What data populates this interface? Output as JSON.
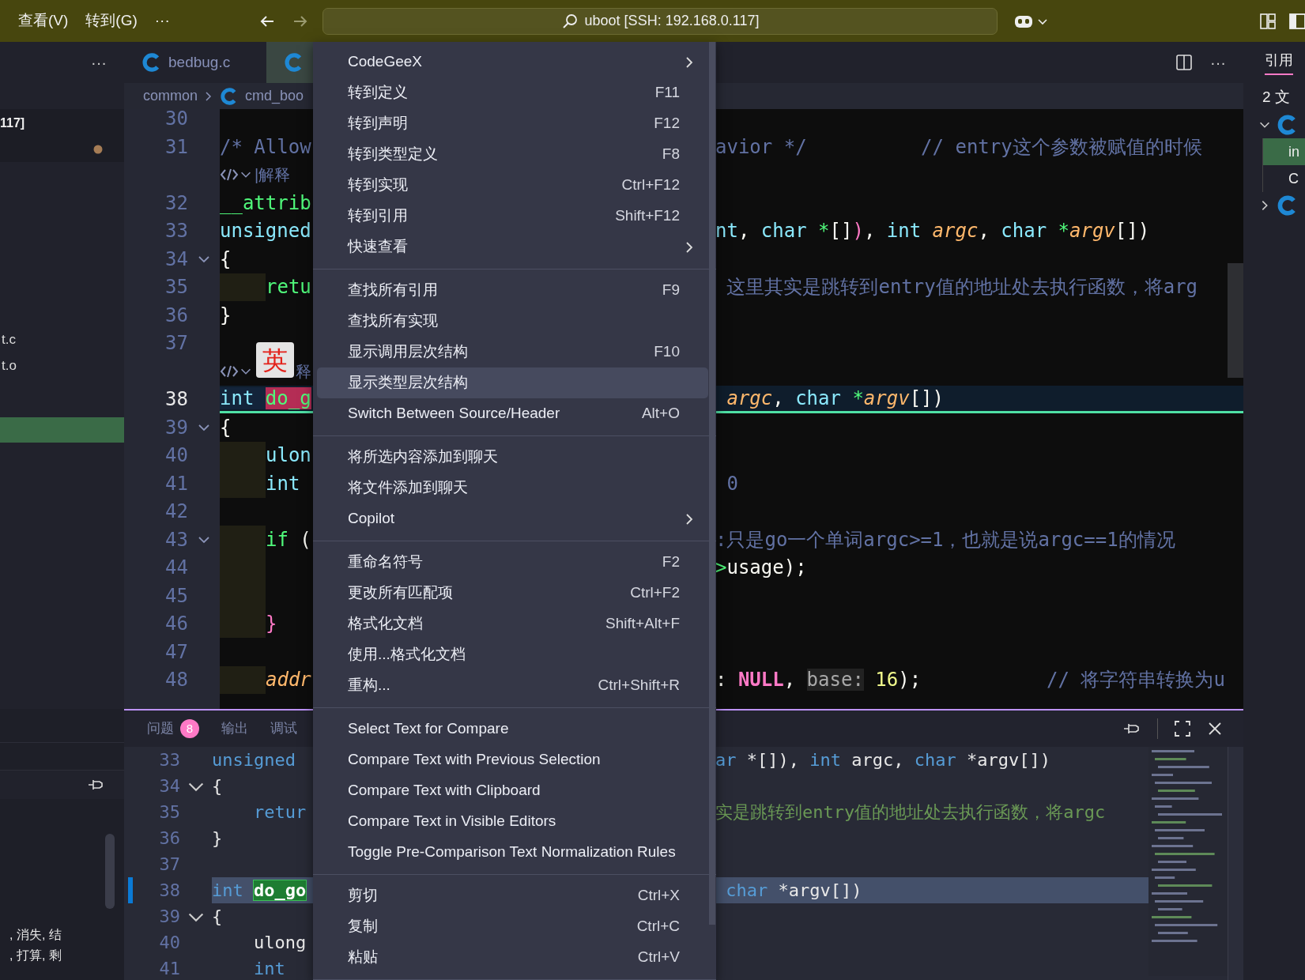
{
  "title_bar": {
    "menus": [
      "查看(V)",
      "转到(G)"
    ],
    "more": "···",
    "search": "uboot [SSH: 192.168.0.117]"
  },
  "sidebar": {
    "more": "···",
    "header": "117]",
    "modified": true,
    "files": [
      "t.c",
      "t.o"
    ],
    "notes": [
      ", 消失, 结",
      ", 打算, 剩"
    ]
  },
  "tabs": [
    {
      "label": "bedbug.c",
      "selected": false
    },
    {
      "selected": true
    }
  ],
  "tab_actions": {
    "more": "···"
  },
  "breadcrumb": [
    "common",
    "cmd_boo"
  ],
  "editor": {
    "lines": [
      {
        "kind": "code",
        "number": "30",
        "fold": false,
        "current": false,
        "guide": false
      },
      {
        "kind": "code",
        "number": "31",
        "fold": false,
        "current": false,
        "guide": false,
        "left": [
          {
            "text": "/* Allow",
            "kind": "comment"
          }
        ],
        "right": [
          {
            "text": "avior */          // entry这个参数被赋值的时候",
            "kind": "comment"
          }
        ]
      },
      {
        "kind": "lens",
        "text": "|解释"
      },
      {
        "kind": "code",
        "number": "32",
        "fold": false,
        "current": false,
        "guide": false,
        "left": [
          {
            "text": "__attrib",
            "kind": "func"
          }
        ]
      },
      {
        "kind": "code",
        "number": "33",
        "fold": false,
        "current": false,
        "guide": false,
        "left": [
          {
            "text": "unsigned",
            "kind": "type"
          }
        ],
        "right": [
          {
            "text": "nt",
            "kind": "type"
          },
          {
            "text": ", ",
            "kind": "plain"
          },
          {
            "text": "char",
            "kind": "type"
          },
          {
            "text": " *",
            "kind": "op"
          },
          {
            "text": "[]",
            "kind": "plain"
          },
          {
            "text": ")",
            "kind": "punct"
          },
          {
            "text": ", ",
            "kind": "plain"
          },
          {
            "text": "int",
            "kind": "type"
          },
          {
            "text": " argc",
            "kind": "param"
          },
          {
            "text": ", ",
            "kind": "plain"
          },
          {
            "text": "char",
            "kind": "type"
          },
          {
            "text": " *",
            "kind": "op"
          },
          {
            "text": "argv",
            "kind": "param"
          },
          {
            "text": "[])",
            "kind": "plain"
          }
        ]
      },
      {
        "kind": "code",
        "number": "34",
        "fold": true,
        "current": false,
        "guide": false,
        "left": [
          {
            "text": "{",
            "kind": "plain"
          }
        ]
      },
      {
        "kind": "code",
        "number": "35",
        "fold": false,
        "current": false,
        "guide": true,
        "left": [
          {
            "text": "retu",
            "kind": "func"
          }
        ],
        "right": [
          {
            "text": " 这里其实是跳转到entry值的地址处去执行函数，将arg",
            "kind": "comment"
          }
        ]
      },
      {
        "kind": "code",
        "number": "36",
        "fold": false,
        "current": false,
        "guide": false,
        "left": [
          {
            "text": "}",
            "kind": "plain"
          }
        ]
      },
      {
        "kind": "code",
        "number": "37",
        "fold": false,
        "current": false,
        "guide": false
      },
      {
        "kind": "lens",
        "text": "释",
        "ime": "英"
      },
      {
        "kind": "code",
        "number": "38",
        "fold": false,
        "current": true,
        "guide": false,
        "left": [
          {
            "text": "int ",
            "kind": "sel-type"
          },
          {
            "text": "do_g",
            "kind": "sel-name"
          }
        ],
        "right": [
          {
            "text": " argc",
            "kind": "param"
          },
          {
            "text": ", ",
            "kind": "plain"
          },
          {
            "text": "char",
            "kind": "type"
          },
          {
            "text": " *",
            "kind": "op"
          },
          {
            "text": "argv",
            "kind": "param"
          },
          {
            "text": "[])",
            "kind": "plain"
          }
        ]
      },
      {
        "kind": "code",
        "number": "39",
        "fold": true,
        "current": false,
        "guide": false,
        "left": [
          {
            "text": "{",
            "kind": "plain"
          }
        ]
      },
      {
        "kind": "code",
        "number": "40",
        "fold": false,
        "current": false,
        "guide": true,
        "left": [
          {
            "text": "ulon",
            "kind": "type"
          }
        ]
      },
      {
        "kind": "code",
        "number": "41",
        "fold": false,
        "current": false,
        "guide": true,
        "left": [
          {
            "text": "int",
            "kind": "type"
          }
        ],
        "right": [
          {
            "text": " 0",
            "kind": "comment"
          }
        ]
      },
      {
        "kind": "code",
        "number": "42",
        "fold": false,
        "current": false,
        "guide": false
      },
      {
        "kind": "code",
        "number": "43",
        "fold": true,
        "current": false,
        "guide": true,
        "left": [
          {
            "text": "if",
            "kind": "func"
          },
          {
            "text": " (",
            "kind": "plain"
          }
        ],
        "right": [
          {
            "text": ":只是go一个单词argc>=1，也就是说argc==1的情况",
            "kind": "comment"
          }
        ]
      },
      {
        "kind": "code",
        "number": "44",
        "fold": false,
        "current": false,
        "guide": true,
        "right": [
          {
            "text": ">",
            "kind": "op"
          },
          {
            "text": "usage);",
            "kind": "plain"
          }
        ]
      },
      {
        "kind": "code",
        "number": "45",
        "fold": false,
        "current": false,
        "guide": true
      },
      {
        "kind": "code",
        "number": "46",
        "fold": false,
        "current": false,
        "guide": true,
        "left": [
          {
            "text": "}",
            "kind": "punct"
          }
        ]
      },
      {
        "kind": "code",
        "number": "47",
        "fold": false,
        "current": false,
        "guide": false
      },
      {
        "kind": "code",
        "number": "48",
        "fold": false,
        "current": false,
        "guide": true,
        "left": [
          {
            "text": "addr",
            "kind": "param"
          }
        ],
        "right": [
          {
            "text": ": ",
            "kind": "plain"
          },
          {
            "text": "NULL",
            "kind": "const"
          },
          {
            "text": ", ",
            "kind": "plain"
          },
          {
            "text": "base:",
            "kind": "hint"
          },
          {
            "text": " 16",
            "kind": "number"
          },
          {
            "text": ");",
            "kind": "plain"
          },
          {
            "text": "           // 将字符串转换为u",
            "kind": "comment"
          }
        ]
      }
    ]
  },
  "panel": {
    "tabs": [
      {
        "label": "问题",
        "badge": "8",
        "selected": false
      },
      {
        "label": "输出",
        "selected": false
      },
      {
        "label": "调试",
        "selected": false
      }
    ],
    "lines": [
      {
        "kind": "code",
        "number": "33",
        "fold": false,
        "current": false,
        "left": [
          {
            "text": "unsigned",
            "kind": "type"
          }
        ],
        "right": [
          {
            "text": "ar",
            "kind": "type"
          },
          {
            "text": " *[]), ",
            "kind": "plain"
          },
          {
            "text": "int",
            "kind": "type"
          },
          {
            "text": " argc, ",
            "kind": "plain"
          },
          {
            "text": "char",
            "kind": "type"
          },
          {
            "text": " *argv[])",
            "kind": "plain"
          }
        ]
      },
      {
        "kind": "code",
        "number": "34",
        "fold": true,
        "current": false,
        "left": [
          {
            "text": "{",
            "kind": "plain"
          }
        ]
      },
      {
        "kind": "code",
        "number": "35",
        "fold": false,
        "current": false,
        "left": [
          {
            "text": "    retur",
            "kind": "type"
          }
        ],
        "right": [
          {
            "text": "实是跳转到entry值的地址处去执行函数，将argc",
            "kind": "comment"
          }
        ]
      },
      {
        "kind": "code",
        "number": "36",
        "fold": false,
        "current": false,
        "left": [
          {
            "text": "}",
            "kind": "plain"
          }
        ]
      },
      {
        "kind": "code",
        "number": "37",
        "fold": false,
        "current": false
      },
      {
        "kind": "code",
        "number": "38",
        "fold": false,
        "current": true,
        "left": [
          {
            "text": "int ",
            "kind": "type"
          },
          {
            "text": "do_go",
            "kind": "sel-name"
          }
        ],
        "right": [
          {
            "text": " char",
            "kind": "type"
          },
          {
            "text": " *argv[])",
            "kind": "plain"
          }
        ]
      },
      {
        "kind": "code",
        "number": "39",
        "fold": true,
        "current": false,
        "left": [
          {
            "text": "{",
            "kind": "plain"
          }
        ]
      },
      {
        "kind": "code",
        "number": "40",
        "fold": false,
        "current": false,
        "left": [
          {
            "text": "    ulong",
            "kind": "plain"
          }
        ]
      },
      {
        "kind": "code",
        "number": "41",
        "fold": false,
        "current": false,
        "left": [
          {
            "text": "    int",
            "kind": "type"
          }
        ]
      }
    ]
  },
  "references": {
    "tab": "引用",
    "summary": "2 文",
    "tree": [
      {
        "expanded": true,
        "children": [
          {
            "label": "in",
            "selected": true
          },
          {
            "label": "C",
            "selected": false
          }
        ]
      },
      {
        "expanded": false
      }
    ]
  },
  "context_menu": {
    "items": [
      {
        "kind": "item",
        "label": "CodeGeeX",
        "submenu": true,
        "highlighted": false
      },
      {
        "kind": "item",
        "label": "转到定义",
        "shortcut": "F11",
        "submenu": false,
        "highlighted": false
      },
      {
        "kind": "item",
        "label": "转到声明",
        "shortcut": "F12",
        "submenu": false,
        "highlighted": false
      },
      {
        "kind": "item",
        "label": "转到类型定义",
        "shortcut": "F8",
        "submenu": false,
        "highlighted": false
      },
      {
        "kind": "item",
        "label": "转到实现",
        "shortcut": "Ctrl+F12",
        "submenu": false,
        "highlighted": false
      },
      {
        "kind": "item",
        "label": "转到引用",
        "shortcut": "Shift+F12",
        "submenu": false,
        "highlighted": false
      },
      {
        "kind": "item",
        "label": "快速查看",
        "submenu": true,
        "highlighted": false
      },
      {
        "kind": "separator"
      },
      {
        "kind": "item",
        "label": "查找所有引用",
        "shortcut": "F9",
        "submenu": false,
        "highlighted": false
      },
      {
        "kind": "item",
        "label": "查找所有实现",
        "submenu": false,
        "highlighted": false
      },
      {
        "kind": "item",
        "label": "显示调用层次结构",
        "shortcut": "F10",
        "submenu": false,
        "highlighted": false
      },
      {
        "kind": "item",
        "label": "显示类型层次结构",
        "submenu": false,
        "highlighted": true
      },
      {
        "kind": "item",
        "label": "Switch Between Source/Header",
        "shortcut": "Alt+O",
        "submenu": false,
        "highlighted": false
      },
      {
        "kind": "separator"
      },
      {
        "kind": "item",
        "label": "将所选内容添加到聊天",
        "submenu": false,
        "highlighted": false
      },
      {
        "kind": "item",
        "label": "将文件添加到聊天",
        "submenu": false,
        "highlighted": false
      },
      {
        "kind": "item",
        "label": "Copilot",
        "submenu": true,
        "highlighted": false
      },
      {
        "kind": "separator"
      },
      {
        "kind": "item",
        "label": "重命名符号",
        "shortcut": "F2",
        "submenu": false,
        "highlighted": false
      },
      {
        "kind": "item",
        "label": "更改所有匹配项",
        "shortcut": "Ctrl+F2",
        "submenu": false,
        "highlighted": false
      },
      {
        "kind": "item",
        "label": "格式化文档",
        "shortcut": "Shift+Alt+F",
        "submenu": false,
        "highlighted": false
      },
      {
        "kind": "item",
        "label": "使用...格式化文档",
        "submenu": false,
        "highlighted": false
      },
      {
        "kind": "item",
        "label": "重构...",
        "shortcut": "Ctrl+Shift+R",
        "submenu": false,
        "highlighted": false
      },
      {
        "kind": "separator"
      },
      {
        "kind": "item",
        "label": "Select Text for Compare",
        "submenu": false,
        "highlighted": false
      },
      {
        "kind": "item",
        "label": "Compare Text with Previous Selection",
        "submenu": false,
        "highlighted": false
      },
      {
        "kind": "item",
        "label": "Compare Text with Clipboard",
        "submenu": false,
        "highlighted": false
      },
      {
        "kind": "item",
        "label": "Compare Text in Visible Editors",
        "submenu": false,
        "highlighted": false
      },
      {
        "kind": "item",
        "label": "Toggle Pre-Comparison Text Normalization Rules",
        "submenu": false,
        "highlighted": false
      },
      {
        "kind": "separator"
      },
      {
        "kind": "item",
        "label": "剪切",
        "shortcut": "Ctrl+X",
        "submenu": false,
        "highlighted": false
      },
      {
        "kind": "item",
        "label": "复制",
        "shortcut": "Ctrl+C",
        "submenu": false,
        "highlighted": false
      },
      {
        "kind": "item",
        "label": "粘贴",
        "shortcut": "Ctrl+V",
        "submenu": false,
        "highlighted": false
      },
      {
        "kind": "separator"
      }
    ]
  }
}
